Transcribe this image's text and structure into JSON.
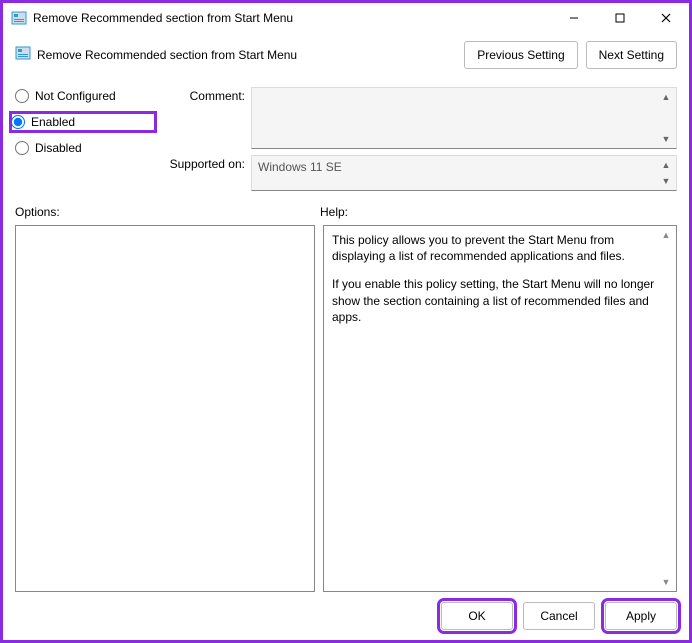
{
  "titlebar": {
    "title": "Remove Recommended section from Start Menu"
  },
  "header": {
    "setting_name": "Remove Recommended section from Start Menu",
    "prev_btn": "Previous Setting",
    "next_btn": "Next Setting"
  },
  "radios": {
    "not_configured": "Not Configured",
    "enabled": "Enabled",
    "disabled": "Disabled",
    "selected": "enabled"
  },
  "fields": {
    "comment_label": "Comment:",
    "supported_label": "Supported on:",
    "supported_value": "Windows 11 SE"
  },
  "sections": {
    "options": "Options:",
    "help": "Help:"
  },
  "help": {
    "p1": "This policy allows you to prevent the Start Menu from displaying a list of recommended applications and files.",
    "p2": "If you enable this policy setting, the Start Menu will no longer show the section containing a list of recommended files and apps."
  },
  "footer": {
    "ok": "OK",
    "cancel": "Cancel",
    "apply": "Apply"
  }
}
